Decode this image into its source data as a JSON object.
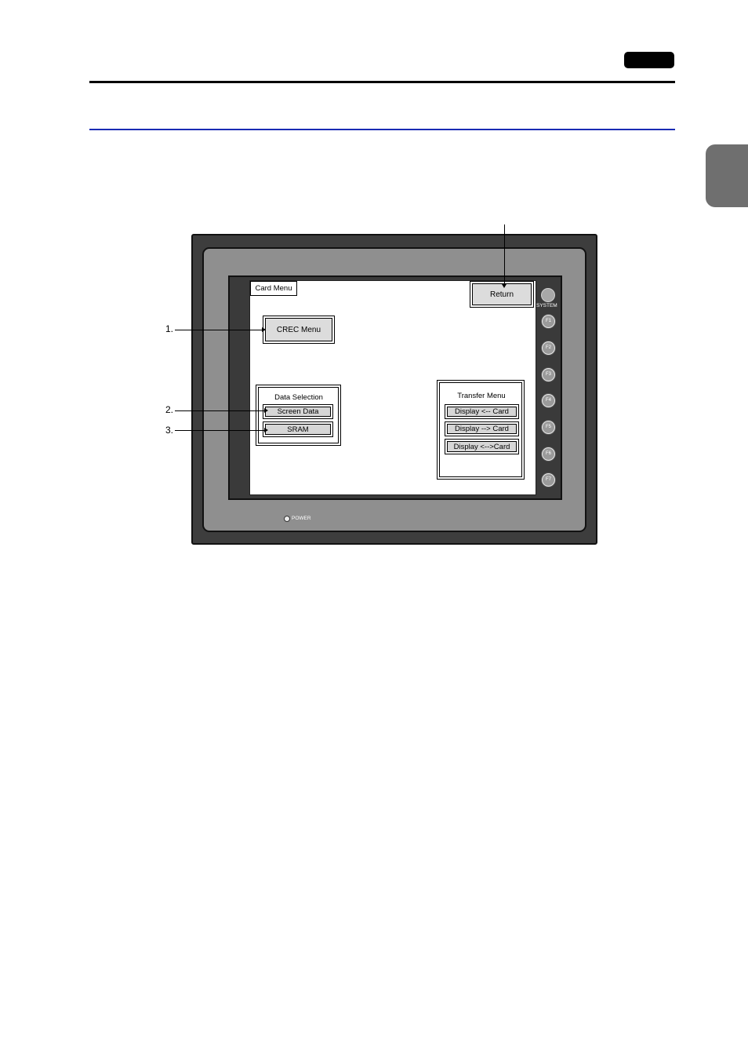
{
  "screen": {
    "card_menu_label": "Card Menu",
    "return_button": "Return",
    "crec_menu_button": "CREC Menu",
    "data_selection": {
      "title": "Data Selection",
      "buttons": [
        "Screen Data",
        "SRAM"
      ]
    },
    "transfer_menu": {
      "title": "Transfer Menu",
      "buttons": [
        "Display <-- Card",
        "Display --> Card",
        "Display <-->Card"
      ]
    }
  },
  "device": {
    "system_label": "SYSTEM",
    "function_keys": [
      "F1",
      "F2",
      "F3",
      "F4",
      "F5",
      "F6",
      "F7"
    ],
    "power_label": "POWER"
  },
  "callouts": [
    "1.",
    "2.",
    "3."
  ]
}
